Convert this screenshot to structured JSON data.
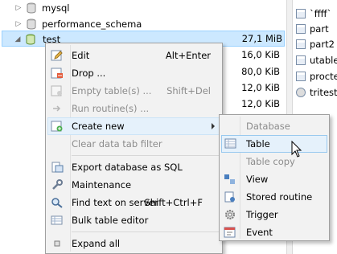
{
  "tree": {
    "rows": [
      {
        "name": "mysql",
        "size": ""
      },
      {
        "name": "performance_schema",
        "size": ""
      },
      {
        "name": "test",
        "size": "27,1 MiB"
      }
    ],
    "child_sizes": [
      "16,0 KiB",
      "80,0 KiB",
      "12,0 KiB",
      "12,0 KiB"
    ]
  },
  "right_panel": {
    "items": [
      "`ffff`",
      "part",
      "part2",
      "utable",
      "procte",
      "tritest"
    ]
  },
  "context_menu": {
    "items": [
      {
        "label": "Edit",
        "shortcut": "Alt+Enter",
        "icon": "edit-icon"
      },
      {
        "label": "Drop ...",
        "shortcut": "",
        "icon": "drop-icon"
      },
      {
        "label": "Empty table(s) ...",
        "shortcut": "Shift+Del",
        "icon": "empty-table-icon"
      },
      {
        "label": "Run routine(s) ...",
        "shortcut": "",
        "icon": "run-routine-icon"
      },
      {
        "label": "Create new",
        "shortcut": "",
        "icon": "create-new-icon"
      },
      {
        "label": "Clear data tab filter",
        "shortcut": "",
        "icon": ""
      },
      {
        "label": "Export database as SQL",
        "shortcut": "",
        "icon": "export-sql-icon"
      },
      {
        "label": "Maintenance",
        "shortcut": "",
        "icon": "wrench-icon"
      },
      {
        "label": "Find text on server",
        "shortcut": "Shift+Ctrl+F",
        "icon": "find-icon"
      },
      {
        "label": "Bulk table editor",
        "shortcut": "",
        "icon": "bulk-editor-icon"
      },
      {
        "label": "Expand all",
        "shortcut": "",
        "icon": "expand-all-icon"
      }
    ]
  },
  "submenu": {
    "items": [
      {
        "label": "Database",
        "icon": ""
      },
      {
        "label": "Table",
        "icon": "table-icon"
      },
      {
        "label": "Table copy",
        "icon": ""
      },
      {
        "label": "View",
        "icon": "view-icon"
      },
      {
        "label": "Stored routine",
        "icon": "stored-routine-icon"
      },
      {
        "label": "Trigger",
        "icon": "trigger-icon"
      },
      {
        "label": "Event",
        "icon": "event-icon"
      }
    ]
  },
  "colors": {
    "selection": "#cce8ff",
    "menu_hover": "#e5f1fb",
    "menu_bg": "#f2f2f2",
    "disabled_text": "#8c8c8c"
  }
}
